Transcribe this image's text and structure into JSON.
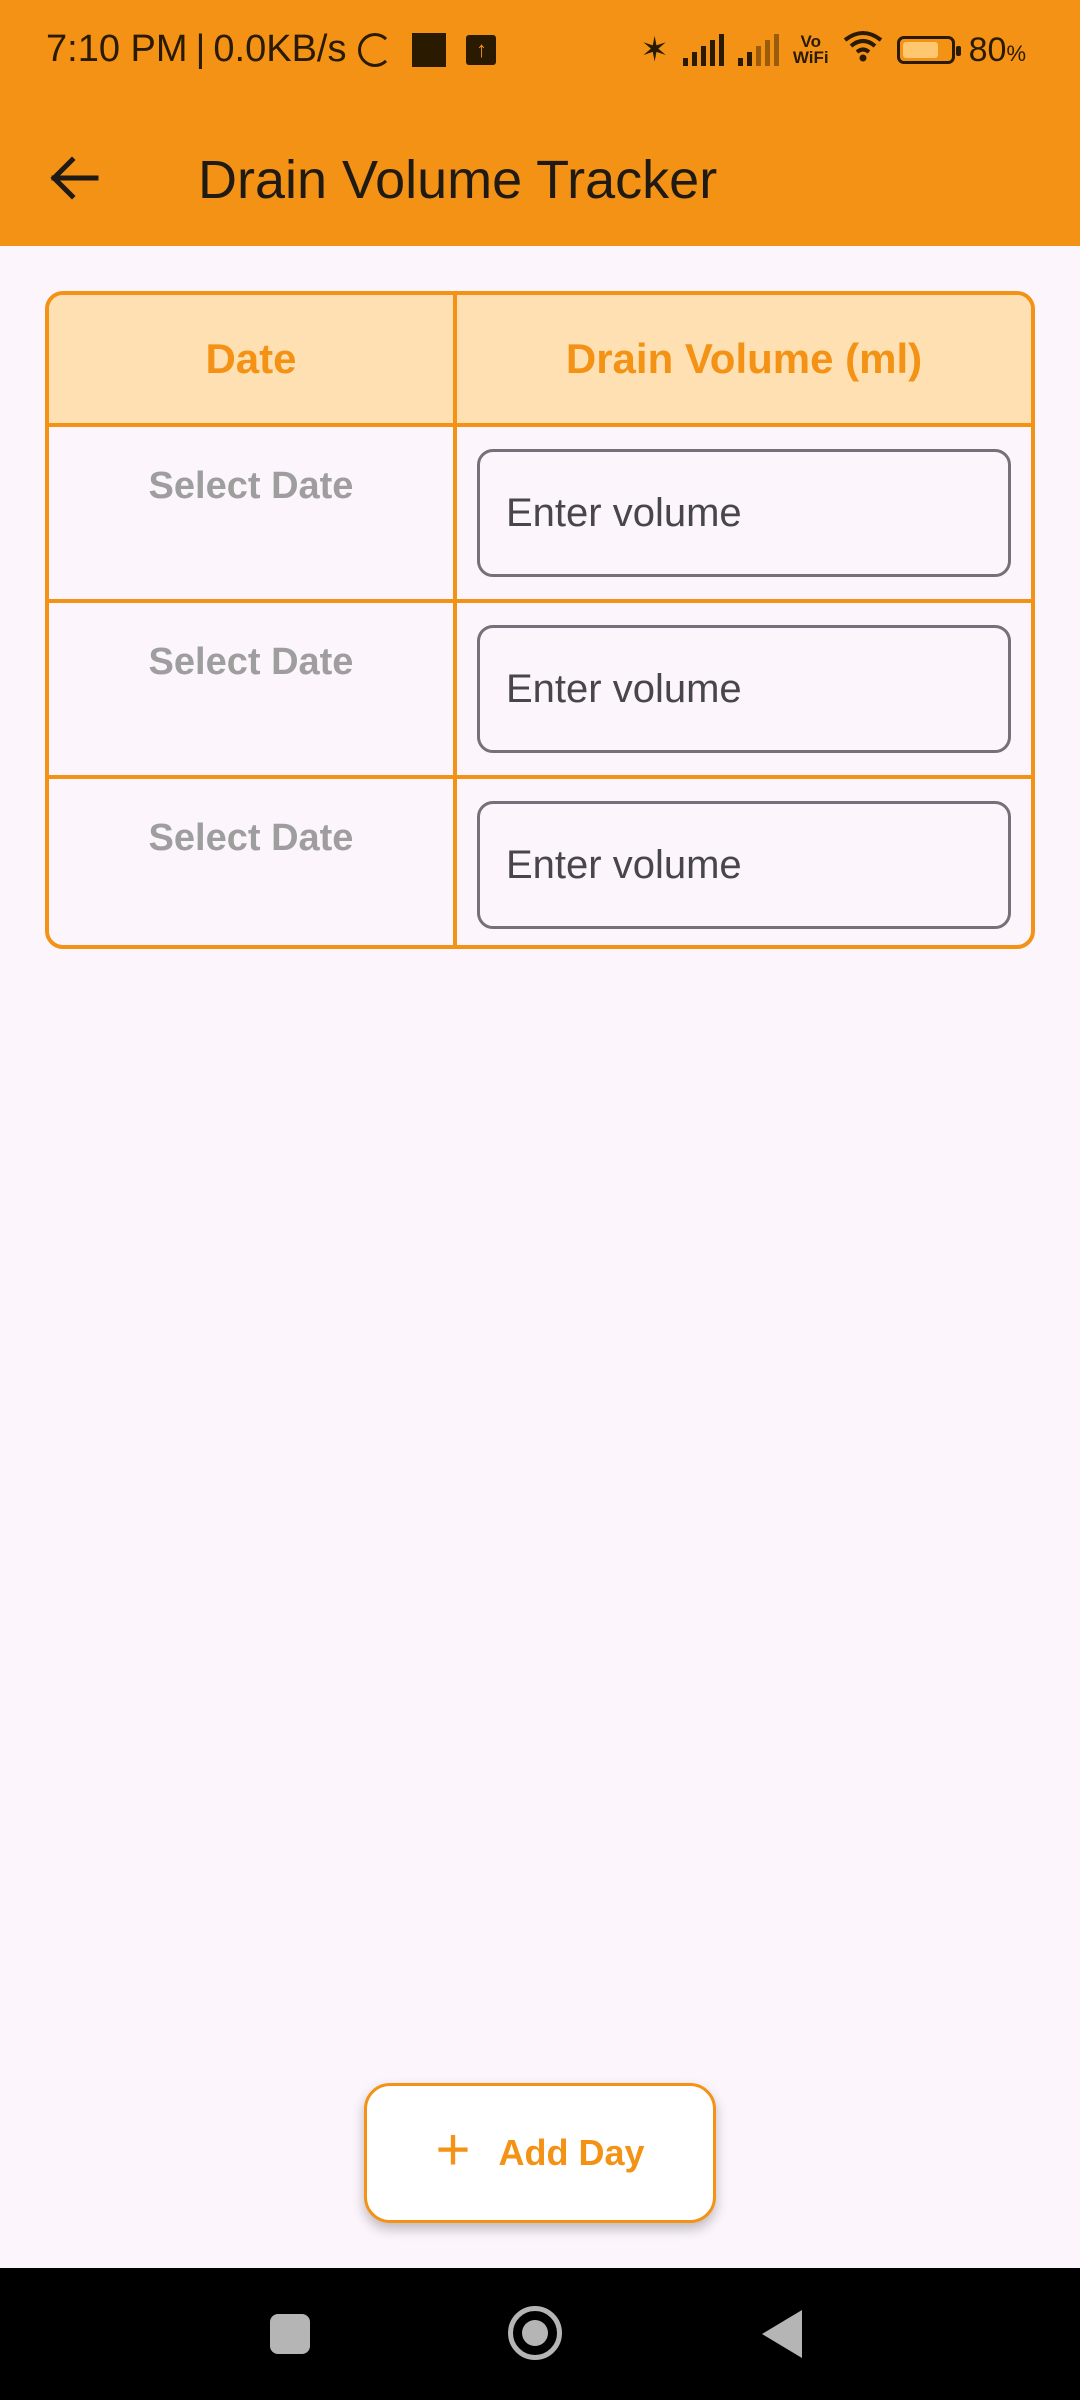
{
  "status_bar": {
    "time": "7:10 PM",
    "separator": "|",
    "network_speed": "0.0KB/s",
    "vowifi_top": "Vo",
    "vowifi_bottom": "WiFi",
    "battery_level": 0.8,
    "battery_percent": "80",
    "battery_unit": "%",
    "icons": [
      "loading-spinner-icon",
      "notification-square-icon",
      "upload-icon",
      "bluetooth-icon",
      "signal-bars-icon",
      "signal-bars-icon",
      "vowifi-icon",
      "wifi-icon",
      "battery-icon"
    ]
  },
  "app_bar": {
    "title": "Drain Volume Tracker",
    "back_icon": "arrow-left-icon"
  },
  "table": {
    "headers": {
      "date": "Date",
      "volume": "Drain Volume (ml)"
    },
    "rows": [
      {
        "date": "Select Date",
        "volume_value": "",
        "volume_placeholder": "Enter volume"
      },
      {
        "date": "Select Date",
        "volume_value": "",
        "volume_placeholder": "Enter volume"
      },
      {
        "date": "Select Date",
        "volume_value": "",
        "volume_placeholder": "Enter volume"
      }
    ]
  },
  "add_button": {
    "icon": "plus-icon",
    "label": "Add Day"
  },
  "colors": {
    "accent": "#f39214",
    "header_bg": "#ffe0b2",
    "page_bg": "#fcf6fc",
    "placeholder_date": "#9e9e9e"
  }
}
